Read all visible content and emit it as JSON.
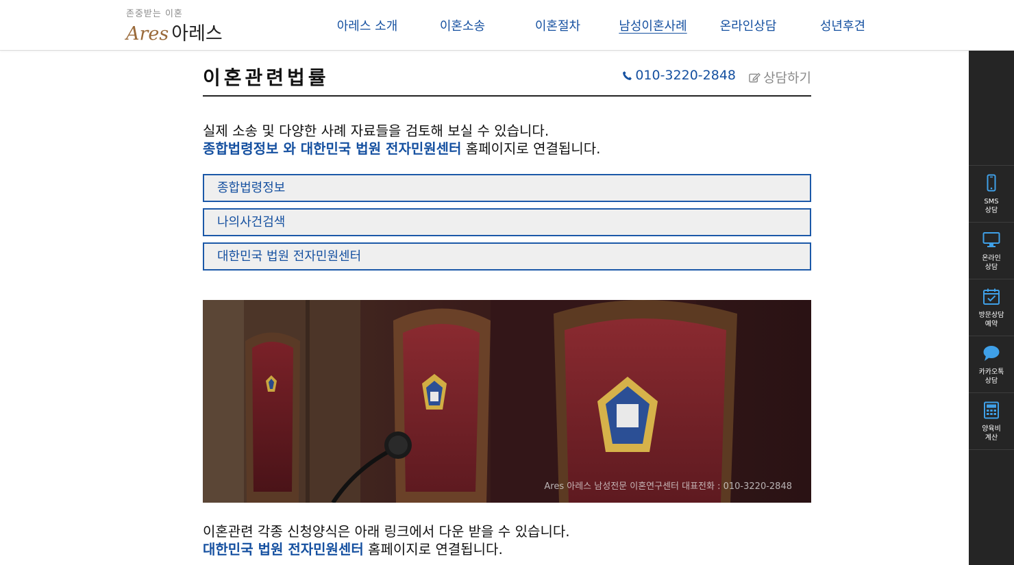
{
  "header": {
    "logo": {
      "tagline": "존중받는 이혼",
      "name_en": "Ares",
      "name_ko": "아레스"
    },
    "nav": [
      {
        "label": "아레스 소개"
      },
      {
        "label": "이혼소송"
      },
      {
        "label": "이혼절차"
      },
      {
        "label": "남성이혼사례"
      },
      {
        "label": "온라인상담"
      },
      {
        "label": "성년후견"
      }
    ]
  },
  "main": {
    "title": "이혼관련법률",
    "phone": "010-3220-2848",
    "consult_label": "상담하기",
    "intro": {
      "line1": "실제 소송 및 다양한 사례 자료들을 검토해 보실 수 있습니다.",
      "highlight": "종합법령정보 와 대한민국 법원 전자민원센터",
      "line2_suffix": " 홈페이지로 연결됩니다."
    },
    "links": [
      {
        "label": "종합법령정보"
      },
      {
        "label": "나의사건검색"
      },
      {
        "label": "대한민국 법원 전자민원센터"
      }
    ],
    "photo_caption": "Ares 아레스 남성전문 이혼연구센터 대표전화 : 010-3220-2848",
    "outro": {
      "line1": "이혼관련 각종 신청양식은 아래 링크에서 다운 받을 수 있습니다.",
      "highlight": "대한민국 법원 전자민원센터",
      "line2_suffix": " 홈페이지로 연결됩니다."
    }
  },
  "sidebar": {
    "items": [
      {
        "label": "SMS\n상담",
        "icon": "mobile-phone-icon"
      },
      {
        "label": "온라인\n상담",
        "icon": "monitor-icon"
      },
      {
        "label": "방문상담\n예약",
        "icon": "calendar-check-icon"
      },
      {
        "label": "카카오톡\n상담",
        "icon": "speech-bubble-icon"
      },
      {
        "label": "양육비\n계산",
        "icon": "calculator-icon"
      }
    ]
  },
  "colors": {
    "accent_blue": "#1550a0",
    "box_border": "#1b58a8",
    "box_bg": "#efefef",
    "sidebar_bg": "#252525",
    "logo_gold": "#9a6a3a"
  }
}
